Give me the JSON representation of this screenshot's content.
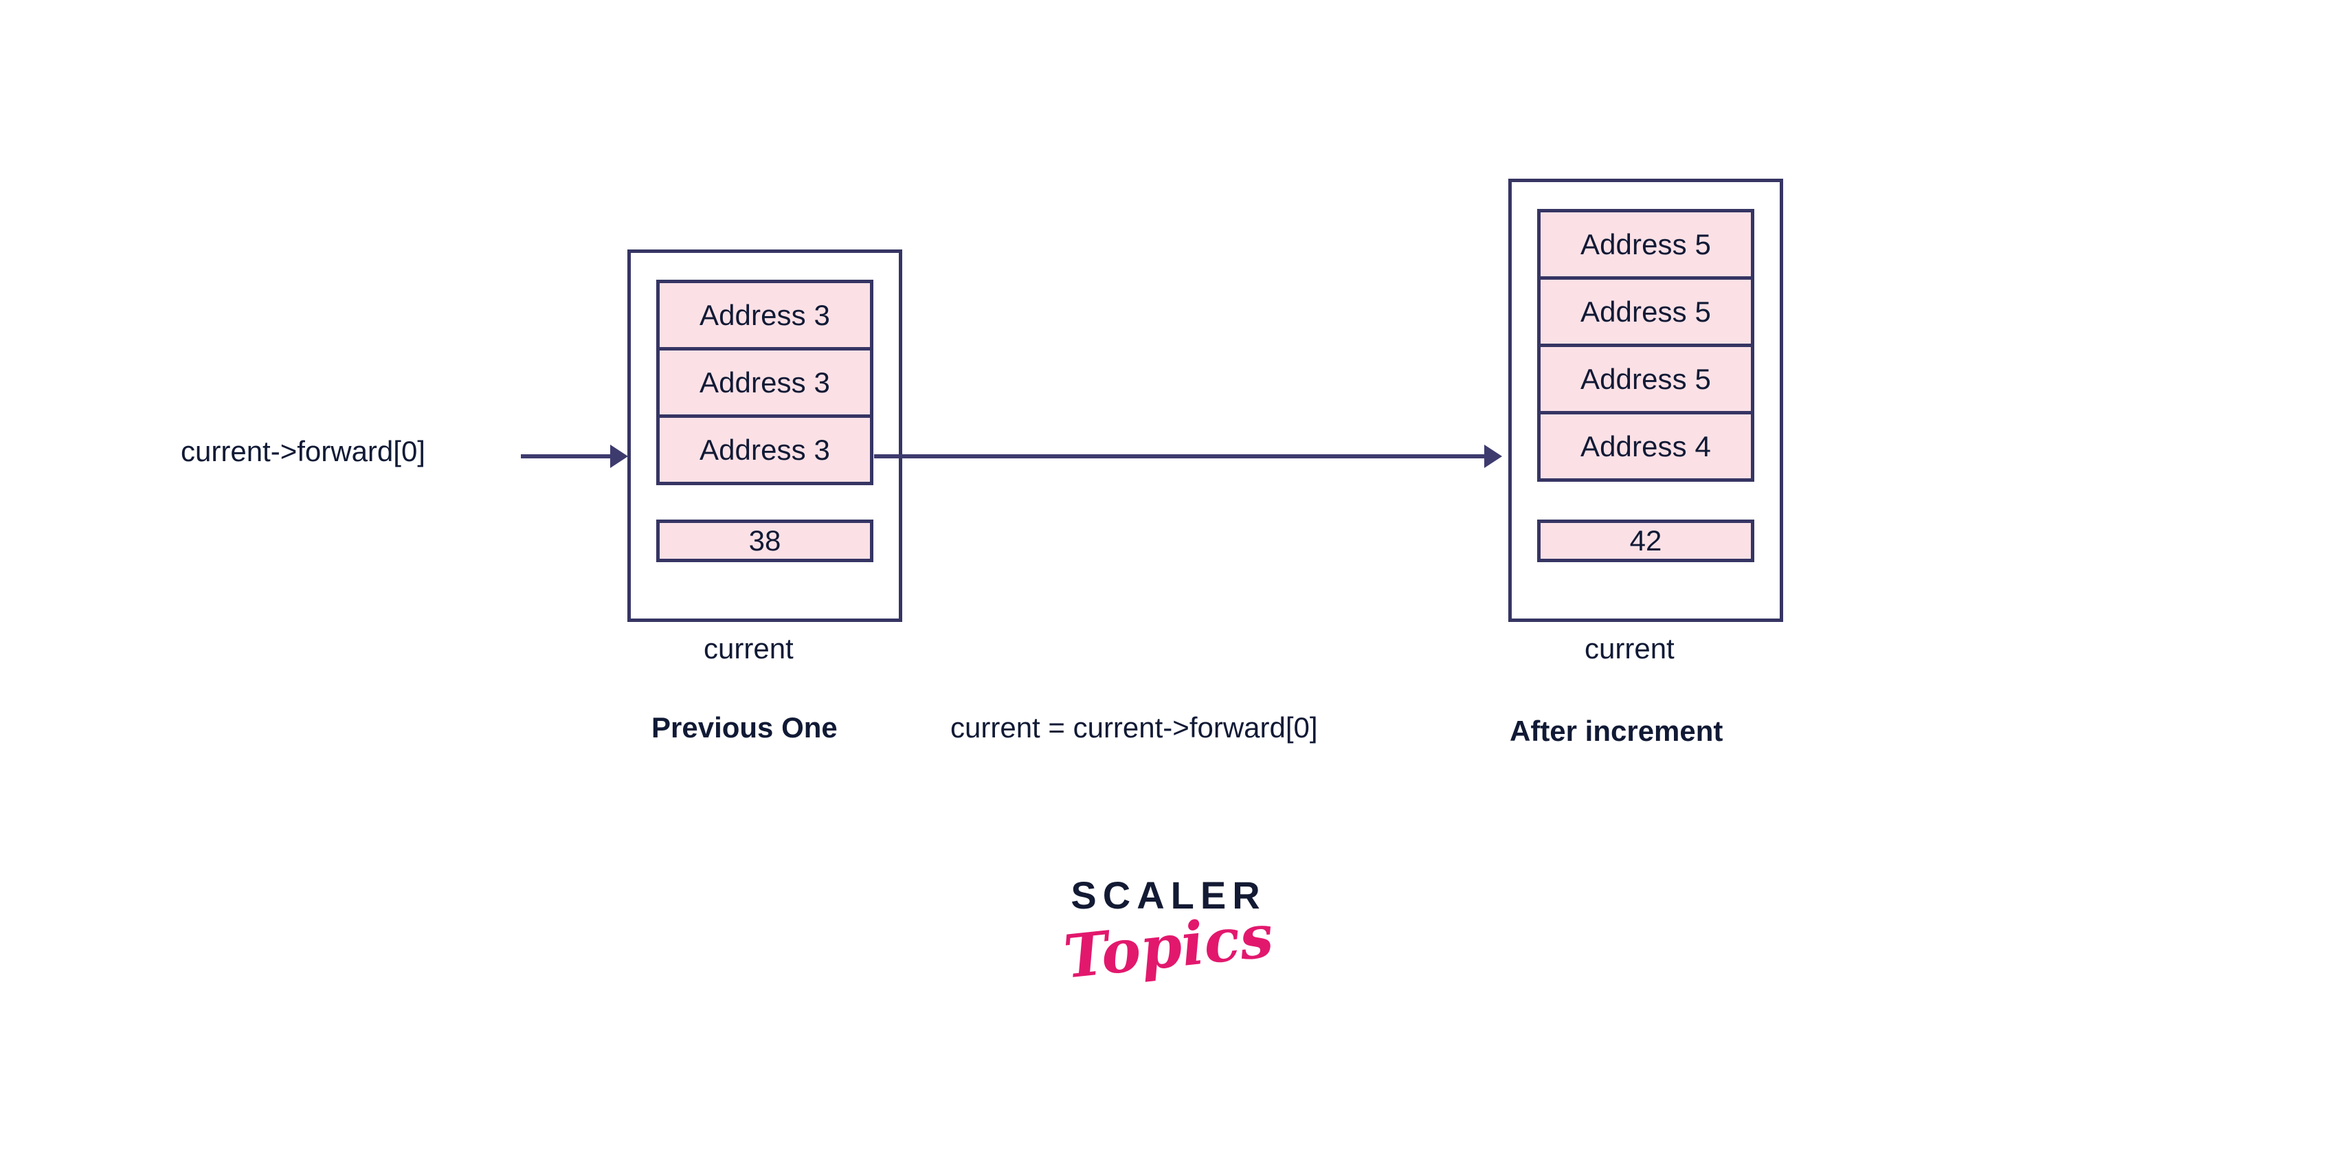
{
  "diagram": {
    "title": "Skip list current pointer increment",
    "colors": {
      "border": "#363563",
      "cell_fill": "#fbe1e6",
      "text": "#111a35",
      "arrow": "#3d3b6e",
      "logo_pink": "#e2186d",
      "logo_navy": "#131a33",
      "background": "#ffffff"
    },
    "pointer_label": "current->forward[0]",
    "nodes": [
      {
        "id": "previous",
        "name_label": "current",
        "caption": "Previous One",
        "caption_bold": true,
        "forward_cells": [
          "Address 3",
          "Address 3",
          "Address 3"
        ],
        "value": "38"
      },
      {
        "id": "after",
        "name_label": "current",
        "caption": "After increment",
        "caption_bold": true,
        "forward_cells": [
          "Address 5",
          "Address 5",
          "Address 5",
          "Address 4"
        ],
        "value": "42"
      }
    ],
    "middle_caption": "current = current->forward[0]"
  },
  "logo": {
    "top": "SCALER",
    "bottom": "Topics"
  }
}
